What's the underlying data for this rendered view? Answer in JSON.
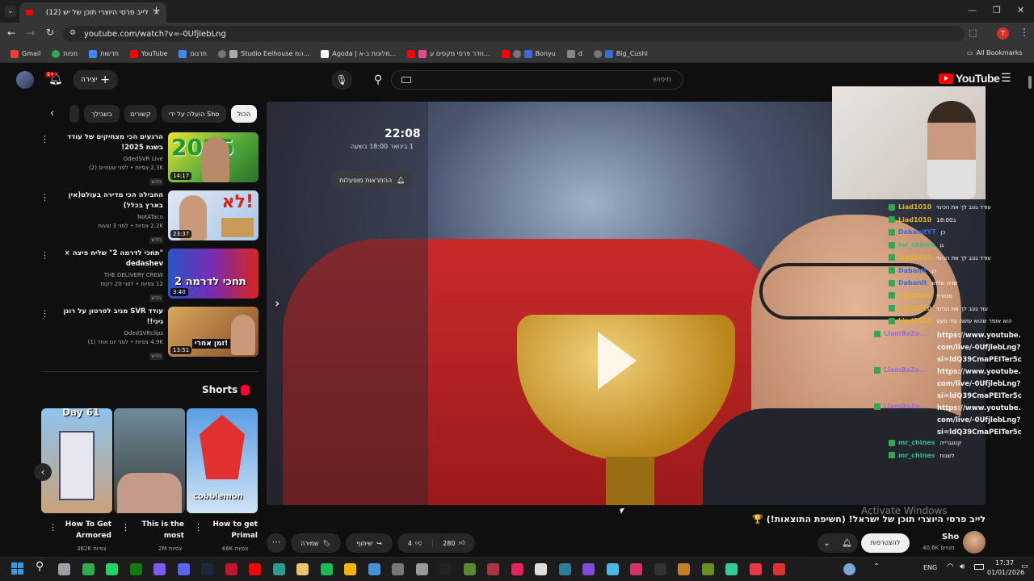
{
  "browser": {
    "tab_title": "לייב פרסי היוצרי תוכן של יש (12)",
    "url": "youtube.com/watch?v=-0UfjlebLng",
    "bookmarks": [
      "Gmail",
      "מפות",
      "חדשות",
      "YouTube",
      "תרגום",
      "Studio Eelhouse המ...",
      "Agoda | מלונות ב-א...",
      "חדר פרסי מקסים ע...",
      "Bonyu",
      "d",
      "Big_Cushi"
    ],
    "all_bookmarks": "All Bookmarks",
    "profile_initial": "T"
  },
  "header": {
    "logo_text": "YouTube",
    "search_placeholder": "חיפוש",
    "create_label": "יצירה",
    "notif_count": "9+"
  },
  "chips": [
    "הכול",
    "הועלה על ידי Sho",
    "קשורים",
    "בשבילך"
  ],
  "related": [
    {
      "title": "הרגעים הכי מצחיקים של עודד בשנת 2025!",
      "channel": "OdedSVR Live",
      "stats": "2.3K צפיות • לפני שעתיים (2)",
      "badge": "חדש",
      "duration": "14:17",
      "thumb_text": "2025"
    },
    {
      "title": "החבילה הכי מדירה בעולם(אין בארץ בכלל)",
      "channel": "NotATaco",
      "stats": "2.2K צפיות • לפני 3 שעות",
      "badge": "חדש",
      "duration": "23:37",
      "thumb_text": "לא!"
    },
    {
      "title": "\"תחכי לדרמה 2\" שליח פיצה × dedashev",
      "channel": "THE DELIVERY CREW",
      "stats": "12 צפיות • לפני 20 דקות",
      "badge": "חדש",
      "duration": "3:40",
      "thumb_text": "תחכי לדרמה 2"
    },
    {
      "title": "עודד SVR מגיב לסרטון על רונן גיגי!!",
      "channel": "OdedSVRclips",
      "stats": "4.9K צפיות • לפני יום אחד (1)",
      "badge": "חדש",
      "duration": "13:51",
      "thumb_text": "זמן אחרי!"
    }
  ],
  "shorts": {
    "heading": "Shorts",
    "items": [
      {
        "title": "How To Get Armored",
        "views": "362K צפיות",
        "thumb_text": "Day 61"
      },
      {
        "title": "This is the most",
        "views": "2M צפיות",
        "thumb_text": ""
      },
      {
        "title": "How to get Primal",
        "views": "66K צפיות",
        "thumb_text": "cobblemon"
      }
    ]
  },
  "player": {
    "overlay_time": "22:08",
    "overlay_date": "1 בינואר 18:00 בשעה",
    "notify_text": "ההתראות מופעלות"
  },
  "chat": [
    {
      "user": "Liad1010",
      "msg": "עודד גונב לך את הכינוי",
      "color": "#e6b422"
    },
    {
      "user": "Liad1010",
      "msg": "18:00ב",
      "color": "#e6b422"
    },
    {
      "user": "DabanitYT",
      "msg": "כן",
      "color": "#3b6cd9"
    },
    {
      "user": "mr_chines",
      "msg": "גן",
      "color": "#2fc08a"
    },
    {
      "user": "Liad1010",
      "msg": "עודד גונב לך את הכינוי",
      "color": "#e6b422"
    },
    {
      "user": "Dabanit",
      "msg": "כן",
      "color": "#3b6cd9"
    },
    {
      "user": "Dabanit",
      "msg": "שניה שלוש",
      "color": "#3b6cd9"
    },
    {
      "user": "Liad1010",
      "msg": "מטורף",
      "color": "#e6b422"
    },
    {
      "user": "Liad1010",
      "msg": "עוד גונב לך את הכינוי",
      "color": "#e6b422"
    },
    {
      "user": "Liad1010",
      "msg": "הוא אומר שהוא עושה עוד מעט",
      "color": "#e6b422"
    },
    {
      "user": "LiamBaZo...",
      "msg": "https://www.youtube.com/live/-0UfjlebLng?si=ldQ39CmaPEITer5c",
      "color": "#9a6cd6"
    },
    {
      "user": "LiamBaZo...",
      "msg": "https://www.youtube.com/live/-0UfjlebLng?si=ldQ39CmaPEITer5c",
      "color": "#9a6cd6"
    },
    {
      "user": "LiamBaZo...",
      "msg": "https://www.youtube.com/live/-0UfjlebLng?si=ldQ39CmaPEITer5c",
      "color": "#9a6cd6"
    },
    {
      "user": "mr_chines",
      "msg": "קטנגרייה",
      "color": "#2fc08a"
    },
    {
      "user": "mr_chines",
      "msg": "לשנות",
      "color": "#2fc08a"
    }
  ],
  "video": {
    "title": "לייב פרסי היוצרי תוכן של ישראל! (חשיפת התוצאות!) 🏆",
    "likes": "280",
    "dislikes": "4",
    "share_label": "שיתוף",
    "save_label": "שמירה",
    "subscribe_label": "להצטרפות",
    "channel_name": "Sho",
    "subscribers": "40.6K מנויים"
  },
  "watermark": {
    "line1": "Activate Windows"
  },
  "taskbar": {
    "time": "17:37",
    "date": "01/01/2026",
    "lang": "ENG"
  }
}
